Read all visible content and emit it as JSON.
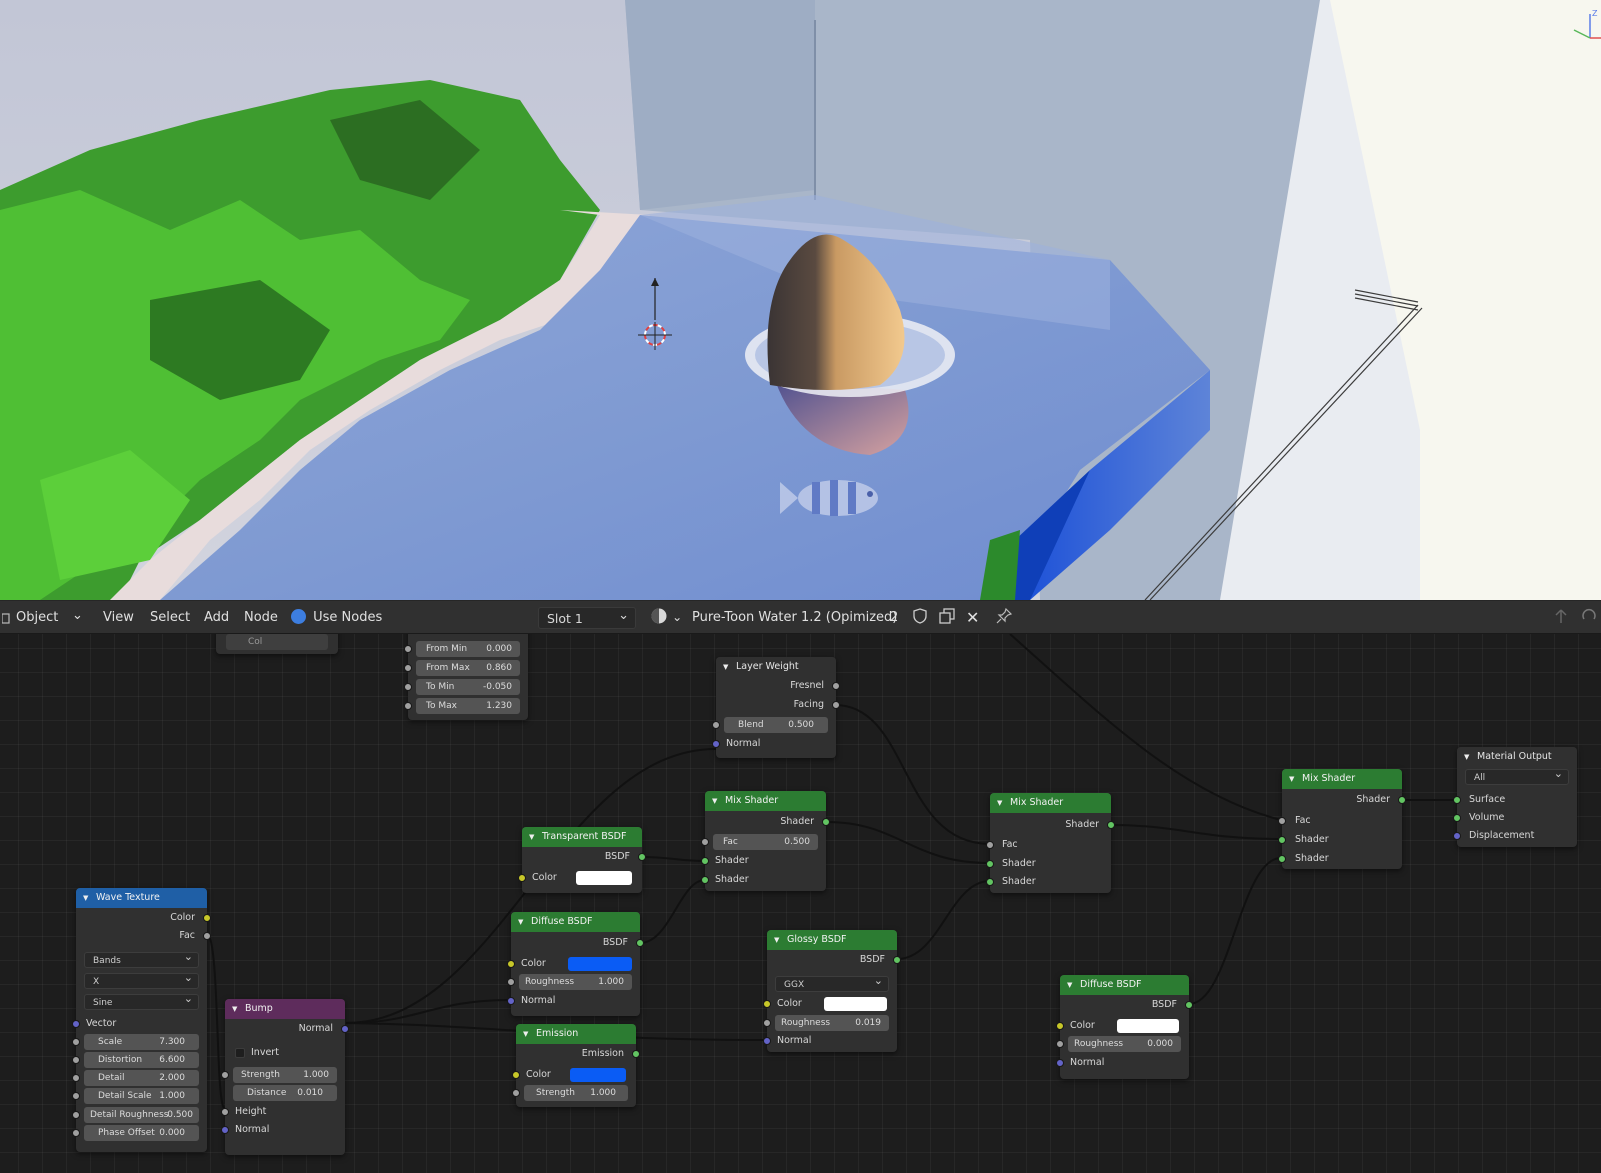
{
  "header": {
    "mode": "Object",
    "menus": [
      "View",
      "Select",
      "Add",
      "Node"
    ],
    "use_nodes": "Use Nodes",
    "slot": "Slot 1",
    "material": "Pure-Toon Water 1.2 (Opimized)",
    "users": "2"
  },
  "nodes": {
    "map_range": {
      "partial_label": "Col",
      "from_min": {
        "label": "From Min",
        "value": "0.000"
      },
      "from_max": {
        "label": "From Max",
        "value": "0.860"
      },
      "to_min": {
        "label": "To Min",
        "value": "-0.050"
      },
      "to_max": {
        "label": "To Max",
        "value": "1.230"
      }
    },
    "layer_weight": {
      "title": "Layer Weight",
      "fresnel": "Fresnel",
      "facing": "Facing",
      "blend": {
        "label": "Blend",
        "value": "0.500"
      },
      "normal": "Normal"
    },
    "transparent": {
      "title": "Transparent BSDF",
      "bsdf": "BSDF",
      "color": "Color",
      "color_value": "#ffffff"
    },
    "mix1": {
      "title": "Mix Shader",
      "shader_out": "Shader",
      "fac": {
        "label": "Fac",
        "value": "0.500"
      },
      "shader_a": "Shader",
      "shader_b": "Shader"
    },
    "mix2": {
      "title": "Mix Shader",
      "shader_out": "Shader",
      "fac": "Fac",
      "shader_a": "Shader",
      "shader_b": "Shader"
    },
    "mix3": {
      "title": "Mix Shader",
      "shader_out": "Shader",
      "fac": "Fac",
      "shader_a": "Shader",
      "shader_b": "Shader"
    },
    "output": {
      "title": "Material Output",
      "target": "All",
      "surface": "Surface",
      "volume": "Volume",
      "displacement": "Displacement"
    },
    "wave": {
      "title": "Wave Texture",
      "color": "Color",
      "fac": "Fac",
      "type": "Bands",
      "direction": "X",
      "profile": "Sine",
      "vector": "Vector",
      "scale": {
        "label": "Scale",
        "value": "7.300"
      },
      "distortion": {
        "label": "Distortion",
        "value": "6.600"
      },
      "detail": {
        "label": "Detail",
        "value": "2.000"
      },
      "detail_scale": {
        "label": "Detail Scale",
        "value": "1.000"
      },
      "detail_roughness": {
        "label": "Detail Roughness",
        "value": "0.500"
      },
      "phase_offset": {
        "label": "Phase Offset",
        "value": "0.000"
      }
    },
    "bump": {
      "title": "Bump",
      "normal_out": "Normal",
      "invert": "Invert",
      "strength": {
        "label": "Strength",
        "value": "1.000"
      },
      "distance": {
        "label": "Distance",
        "value": "0.010"
      },
      "height": "Height",
      "normal": "Normal"
    },
    "diffuse1": {
      "title": "Diffuse BSDF",
      "bsdf": "BSDF",
      "color": "Color",
      "color_value": "#0a5cf5",
      "roughness": {
        "label": "Roughness",
        "value": "1.000"
      },
      "normal": "Normal"
    },
    "emission": {
      "title": "Emission",
      "emission": "Emission",
      "color": "Color",
      "color_value": "#0a5cf5",
      "strength": {
        "label": "Strength",
        "value": "1.000"
      }
    },
    "glossy": {
      "title": "Glossy BSDF",
      "bsdf": "BSDF",
      "distribution": "GGX",
      "color": "Color",
      "color_value": "#ffffff",
      "roughness": {
        "label": "Roughness",
        "value": "0.019"
      },
      "normal": "Normal"
    },
    "diffuse2": {
      "title": "Diffuse BSDF",
      "bsdf": "BSDF",
      "color": "Color",
      "color_value": "#ffffff",
      "roughness": {
        "label": "Roughness",
        "value": "0.000"
      },
      "normal": "Normal"
    }
  }
}
